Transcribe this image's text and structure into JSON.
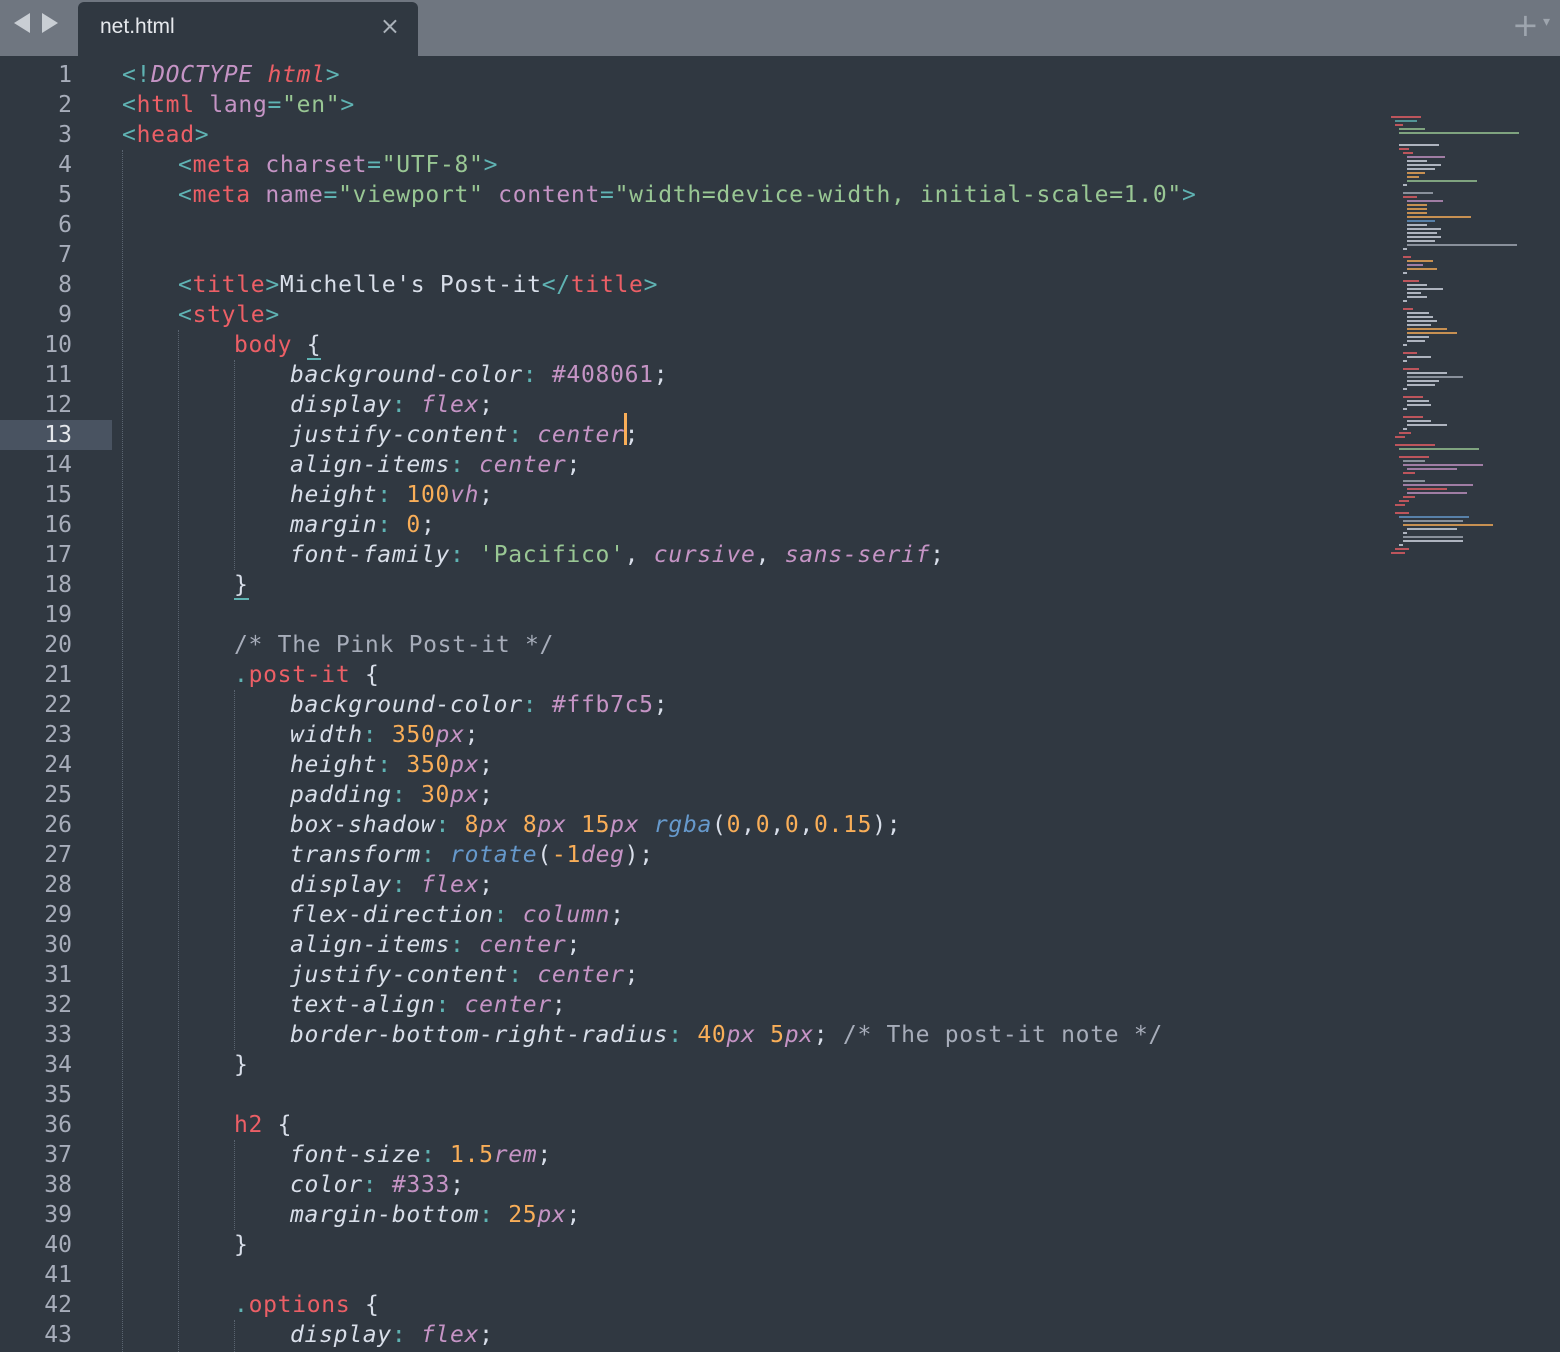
{
  "tab": {
    "title": "net.html",
    "close": "×"
  },
  "toolbar": {
    "new_tab": "+",
    "menu": "▾"
  },
  "editor": {
    "current_line": 13,
    "lines": [
      {
        "n": "1"
      },
      {
        "n": "2"
      },
      {
        "n": "3"
      },
      {
        "n": "4"
      },
      {
        "n": "5"
      },
      {
        "n": "6"
      },
      {
        "n": "7"
      },
      {
        "n": "8"
      },
      {
        "n": "9"
      },
      {
        "n": "10"
      },
      {
        "n": "11"
      },
      {
        "n": "12"
      },
      {
        "n": "13"
      },
      {
        "n": "14"
      },
      {
        "n": "15"
      },
      {
        "n": "16"
      },
      {
        "n": "17"
      },
      {
        "n": "18"
      },
      {
        "n": "19"
      },
      {
        "n": "20"
      },
      {
        "n": "21"
      },
      {
        "n": "22"
      },
      {
        "n": "23"
      },
      {
        "n": "24"
      },
      {
        "n": "25"
      },
      {
        "n": "26"
      },
      {
        "n": "27"
      },
      {
        "n": "28"
      },
      {
        "n": "29"
      },
      {
        "n": "30"
      },
      {
        "n": "31"
      },
      {
        "n": "32"
      },
      {
        "n": "33"
      },
      {
        "n": "34"
      },
      {
        "n": "35"
      },
      {
        "n": "36"
      },
      {
        "n": "37"
      },
      {
        "n": "38"
      },
      {
        "n": "39"
      },
      {
        "n": "40"
      },
      {
        "n": "41"
      },
      {
        "n": "42"
      },
      {
        "n": "43"
      }
    ],
    "code": {
      "l1": [
        "<!",
        "DOCTYPE",
        " ",
        "html",
        ">"
      ],
      "l2": [
        "<",
        "html",
        " ",
        "lang",
        "=",
        "\"",
        "en",
        "\"",
        ">"
      ],
      "l3": [
        "<",
        "head",
        ">"
      ],
      "l4": [
        "<",
        "meta",
        " ",
        "charset",
        "=",
        "\"",
        "UTF-8",
        "\"",
        ">"
      ],
      "l5": [
        "<",
        "meta",
        " ",
        "name",
        "=",
        "\"",
        "viewport",
        "\"",
        " ",
        "content",
        "=",
        "\"",
        "width=device-width, initial-scale=1.0",
        "\"",
        ">"
      ],
      "l8": [
        "<",
        "title",
        ">",
        "Michelle's Post-it",
        "</",
        "title",
        ">"
      ],
      "l9": [
        "<",
        "style",
        ">"
      ],
      "l10": [
        "body",
        " ",
        "{"
      ],
      "l11": [
        "background-color",
        ": ",
        "#408061",
        ";"
      ],
      "l12": [
        "display",
        ": ",
        "flex",
        ";"
      ],
      "l13": [
        "justify-content",
        ": ",
        "center",
        ";"
      ],
      "l14": [
        "align-items",
        ": ",
        "center",
        ";"
      ],
      "l15": [
        "height",
        ": ",
        "100",
        "vh",
        ";"
      ],
      "l16": [
        "margin",
        ": ",
        "0",
        ";"
      ],
      "l17": [
        "font-family",
        ": ",
        "'Pacifico'",
        ", ",
        "cursive",
        ", ",
        "sans-serif",
        ";"
      ],
      "l18": [
        "}"
      ],
      "l20": [
        "/* The Pink Post-it */"
      ],
      "l21": [
        ".",
        "post-it",
        " {"
      ],
      "l22": [
        "background-color",
        ": ",
        "#ffb7c5",
        ";"
      ],
      "l23": [
        "width",
        ": ",
        "350",
        "px",
        ";"
      ],
      "l24": [
        "height",
        ": ",
        "350",
        "px",
        ";"
      ],
      "l25": [
        "padding",
        ": ",
        "30",
        "px",
        ";"
      ],
      "l26": [
        "box-shadow",
        ": ",
        "8",
        "px",
        " ",
        "8",
        "px",
        " ",
        "15",
        "px",
        " ",
        "rgba",
        "(",
        "0",
        ",",
        "0",
        ",",
        "0",
        ",",
        "0.15",
        ");"
      ],
      "l27": [
        "transform",
        ": ",
        "rotate",
        "(",
        "-1",
        "deg",
        ");"
      ],
      "l28": [
        "display",
        ": ",
        "flex",
        ";"
      ],
      "l29": [
        "flex-direction",
        ": ",
        "column",
        ";"
      ],
      "l30": [
        "align-items",
        ": ",
        "center",
        ";"
      ],
      "l31": [
        "justify-content",
        ": ",
        "center",
        ";"
      ],
      "l32": [
        "text-align",
        ": ",
        "center",
        ";"
      ],
      "l33": [
        "border-bottom-right-radius",
        ": ",
        "40",
        "px",
        " ",
        "5",
        "px",
        "; ",
        "/* The post-it note */"
      ],
      "l34": [
        "}"
      ],
      "l36": [
        "h2",
        " {"
      ],
      "l37": [
        "font-size",
        ": ",
        "1.5",
        "rem",
        ";"
      ],
      "l38": [
        "color",
        ": ",
        "#333",
        ";"
      ],
      "l39": [
        "margin-bottom",
        ": ",
        "25",
        "px",
        ";"
      ],
      "l40": [
        "}"
      ],
      "l42": [
        ".",
        "options",
        " {"
      ],
      "l43": [
        "display",
        ": ",
        "flex",
        ";"
      ]
    }
  },
  "colors": {
    "background": "#303841",
    "tab_bar": "#6f7680",
    "punctuation": "#5fb3b3",
    "tag": "#ec5f66",
    "attribute": "#c594c5",
    "string": "#99c794",
    "number": "#f9ae58",
    "comment": "#a7adba",
    "function": "#6699cc",
    "caret": "#f9ae58"
  }
}
